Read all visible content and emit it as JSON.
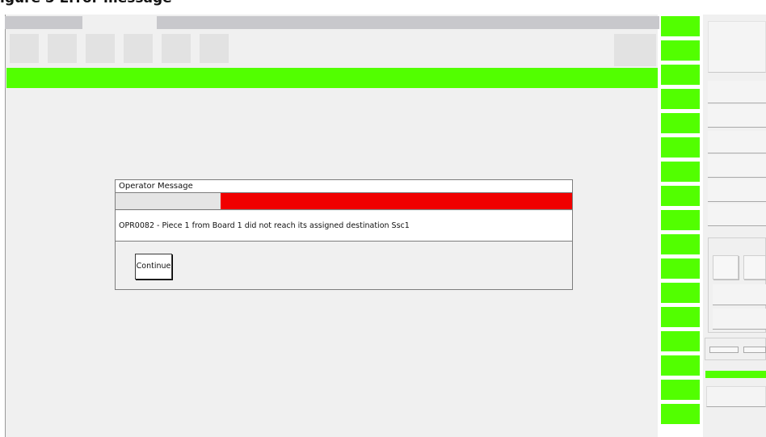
{
  "caption": "igure 5 Error message",
  "colors": {
    "accent_green": "#52ff00",
    "alert_red": "#f00000"
  },
  "dialog": {
    "title": "Operator Message",
    "progress_fraction": 0.77,
    "message": "OPR0082 - Piece 1 from Board 1 did not reach its assigned destination Ssc1",
    "continue_label": "Continue"
  }
}
